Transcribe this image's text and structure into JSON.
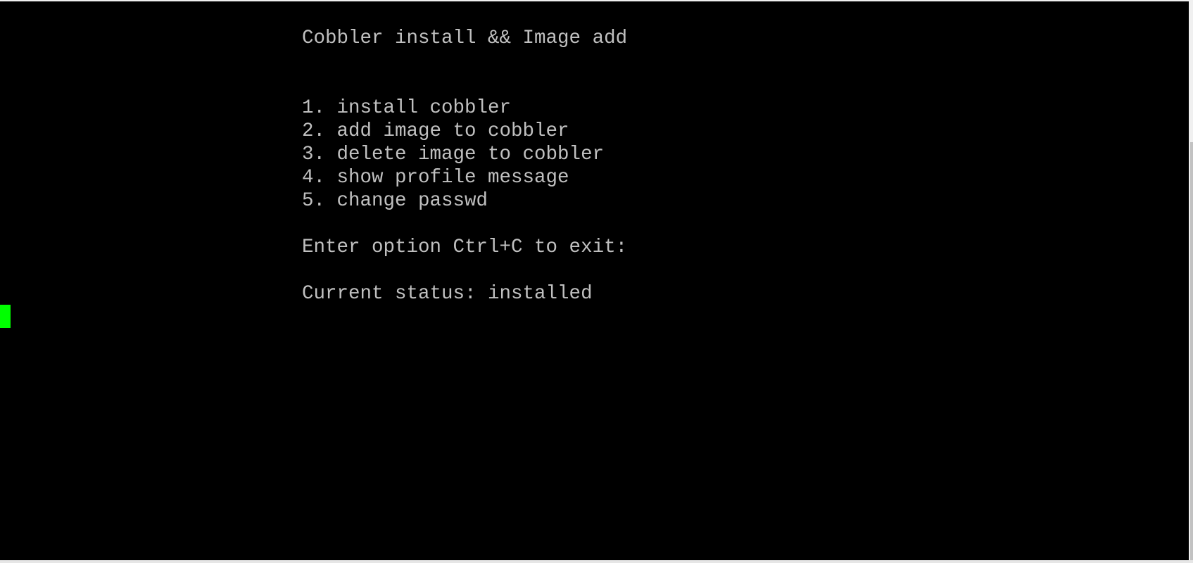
{
  "terminal": {
    "title": "Cobbler install && Image add",
    "menu": [
      "1. install cobbler",
      "2. add image to cobbler",
      "3. delete image to cobbler",
      "4. show profile message",
      "5. change passwd"
    ],
    "prompt": "Enter option Ctrl+C to exit:",
    "status": "Current status: installed"
  },
  "colors": {
    "background": "#000000",
    "text": "#c0c0c0",
    "cursor": "#00ff00"
  }
}
